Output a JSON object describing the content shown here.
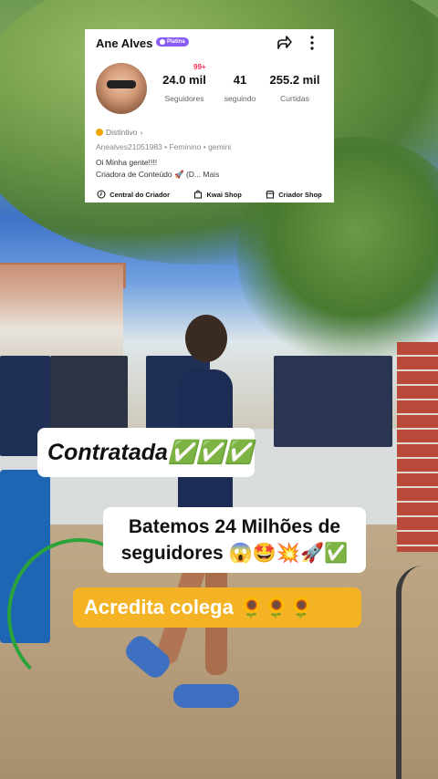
{
  "profile": {
    "name": "Ane Alves",
    "badge": "Platina",
    "notifications": "99+",
    "stats": [
      {
        "value": "24.0 mil",
        "label": "Seguidores"
      },
      {
        "value": "41",
        "label": "seguindo"
      },
      {
        "value": "255.2 mil",
        "label": "Curtidas"
      }
    ],
    "distintivo": "Distintivo",
    "info_line": "Anealves21051983  •  Feminino  •  gemini",
    "bio_line1": "Oi Minha gente!!!!",
    "bio_line2": "Criadora de Conteúdo 🚀 (D...",
    "bio_more": "Mais",
    "links": [
      {
        "label": "Central do Criador",
        "icon": "creator-center-icon"
      },
      {
        "label": "Kwai Shop",
        "icon": "shopping-bag-icon"
      },
      {
        "label": "Criador Shop",
        "icon": "store-icon"
      }
    ]
  },
  "captions": {
    "hired": "Contratada✅✅✅",
    "milestone": "Batemos 24 Milhões de seguidores 😱🤩💥🚀✅",
    "believe": "Acredita colega 🌻🌻🌻"
  },
  "colors": {
    "badge": "#8a5cf6",
    "notification": "#ff2d55",
    "caption_yellow": "#f4b324"
  }
}
